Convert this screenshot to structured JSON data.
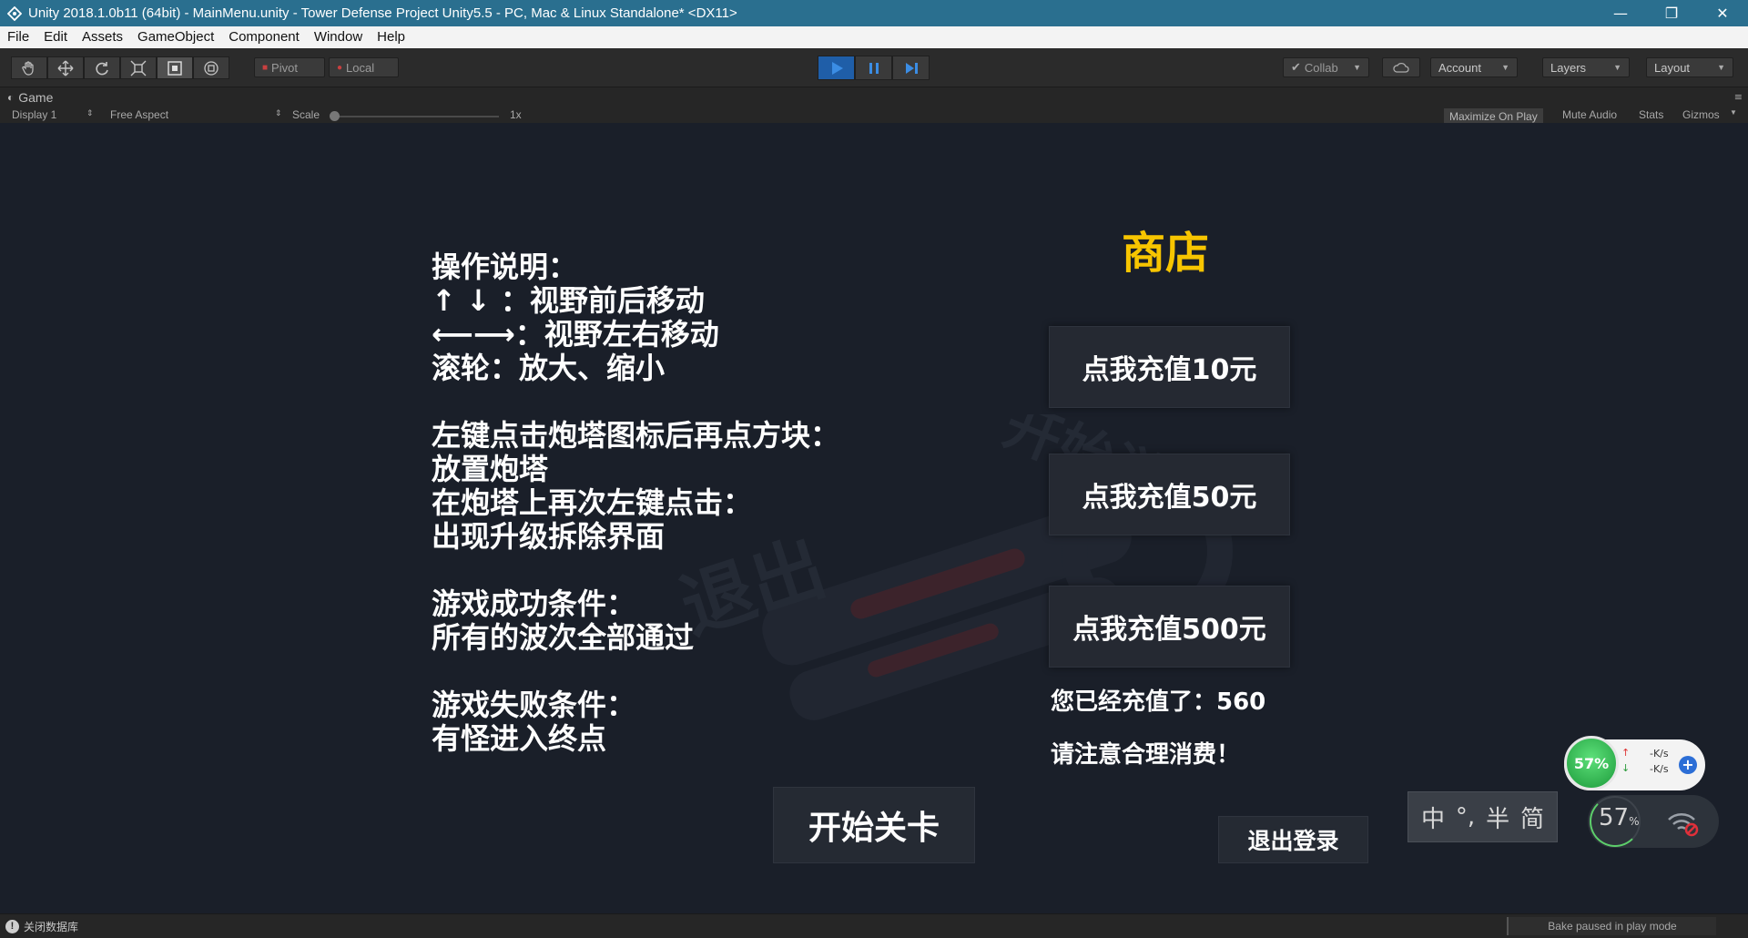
{
  "window": {
    "title": "Unity 2018.1.0b11 (64bit) - MainMenu.unity - Tower Defense Project Unity5.5 - PC, Mac & Linux Standalone* <DX11>",
    "minimize": "—",
    "restore": "❐",
    "close": "✕"
  },
  "menubar": {
    "items": [
      "File",
      "Edit",
      "Assets",
      "GameObject",
      "Component",
      "Window",
      "Help"
    ]
  },
  "toolbar": {
    "pivot": "Pivot",
    "local": "Local",
    "collab": "Collab",
    "account": "Account",
    "layers": "Layers",
    "layout": "Layout"
  },
  "game_view": {
    "tab_label": "Game",
    "display": "Display 1",
    "aspect": "Free Aspect",
    "scale_label": "Scale",
    "scale_value": "1x",
    "maximize": "Maximize On Play",
    "mute": "Mute Audio",
    "stats": "Stats",
    "gizmos": "Gizmos"
  },
  "instructions": {
    "lines": [
      "操作说明：",
      "↑ ↓ ：视野前后移动",
      "⟵⟶：视野左右移动",
      "滚轮：放大、缩小",
      "",
      "左键点击炮塔图标后再点方块：",
      "放置炮塔",
      "在炮塔上再次左键点击：",
      "出现升级拆除界面",
      "",
      "游戏成功条件：",
      "所有的波次全部通过",
      "",
      "游戏失败条件：",
      "有怪进入终点"
    ]
  },
  "shop": {
    "title": "商店",
    "recharge_10": "点我充值10元",
    "recharge_50": "点我充值50元",
    "recharge_500": "点我充值500元",
    "recharged_label": "您已经充值了：560",
    "notice": "请注意合理消费！"
  },
  "buttons": {
    "start_level": "开始关卡",
    "logout": "退出登录"
  },
  "ime": {
    "lang": "中",
    "punct": "°,",
    "width": "半",
    "script": "简"
  },
  "widgets": {
    "net_percent": "57%",
    "up_speed": "-K/s",
    "down_speed": "-K/s",
    "cpu_value": "57",
    "cpu_unit": "%"
  },
  "statusbar": {
    "left_text": "关闭数据库",
    "right_text": "Bake paused in play mode"
  },
  "colors": {
    "title_bar": "#2a6f8f",
    "play_active": "#1f5ea8",
    "shop_title": "#f7c500",
    "viewport_bg": "#1a1f29"
  }
}
